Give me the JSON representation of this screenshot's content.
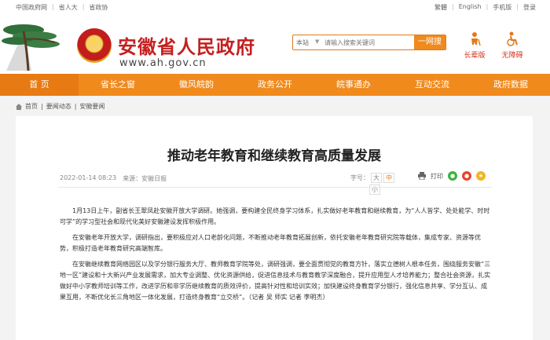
{
  "topbar": {
    "left_links": [
      "中国政府网",
      "省人大",
      "省政协"
    ],
    "right_links": [
      "繁體",
      "English",
      "手机版",
      "登录"
    ]
  },
  "header": {
    "site_title": "安徽省人民政府",
    "site_domain": "www.ah.gov.cn",
    "search_scope": "本站",
    "search_placeholder": "请输入搜索关键词",
    "search_button": "一网搜",
    "tools": [
      {
        "label": "长辈版",
        "icon": "elder-icon"
      },
      {
        "label": "无障碍",
        "icon": "accessibility-icon"
      }
    ]
  },
  "nav": {
    "items": [
      "首 页",
      "省长之窗",
      "徽风皖韵",
      "政务公开",
      "皖事通办",
      "互动交流",
      "政府数据"
    ]
  },
  "breadcrumb": [
    "首页",
    "要闻动态",
    "安徽要闻"
  ],
  "article": {
    "title": "推动老年教育和继续教育高质量发展",
    "date": "2022-01-14 08:23",
    "source": "来源：安徽日报",
    "font_size_label": "字号：",
    "font_large": "大",
    "font_medium": "中",
    "font_small": "小",
    "print_label": "打印",
    "share_icons": [
      "wechat-icon",
      "weibo-icon",
      "qzone-icon"
    ],
    "paragraphs": [
      "1月13日上午，副省长王翠凤赴安徽开放大学调研。她强调，要构建全民终身学习体系，扎实做好老年教育和继续教育，为“人人皆学、处处能学、时时可学”的学习型社会和现代化美好安徽建设发挥积极作用。",
      "在安徽老年开放大学，调研指出，要积极应对人口老龄化问题，不断推动老年教育拓展创新，依托安徽老年教育研究院等载体，集成专家、资源等优势，积极打造老年教育研究高端智库。",
      "在安徽继续教育网络园区以及学分银行服务大厅、教师教育学院等处，调研强调，要全面贯彻党的教育方针，落实立德树人根本任务，围绕服务安徽“三地一区”建设和十大新兴产业发展需求，加大专业调整、优化资源供给，促进信息技术与教育教学深度融合，提升应用型人才培养能力；整合社会资源，扎实做好中小学教师培训等工作，改进学历和非学历继续教育的质效评价，提高针对性和培训实效；加快建设终身教育学分银行，强化信息共享、学分互认、成果互用，不断优化长三角地区一体化发展，打造终身教育“立交桥”。（记者 吴 师实 记者 李明杰）"
    ]
  },
  "colors": {
    "accent_orange": "#f08a1c",
    "brand_red": "#c51f1f"
  }
}
